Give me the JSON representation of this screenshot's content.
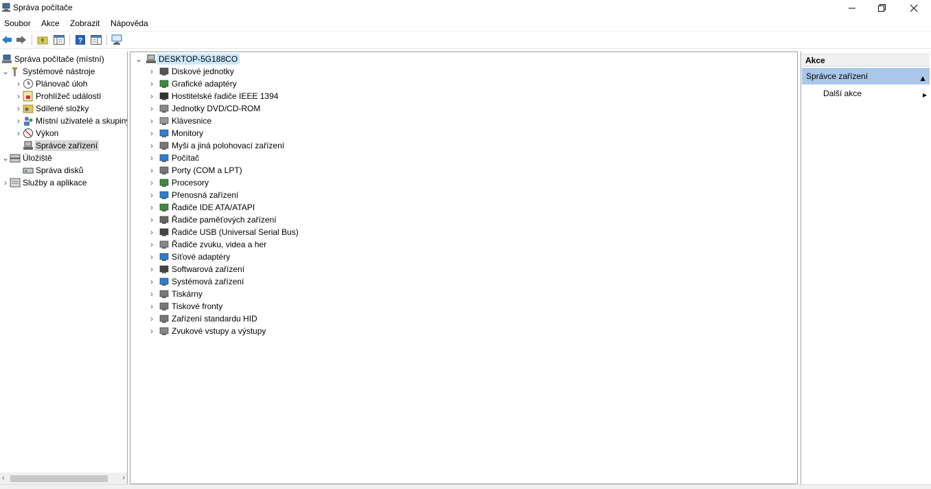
{
  "window": {
    "title": "Správa počítače"
  },
  "menu": {
    "file": "Soubor",
    "action": "Akce",
    "view": "Zobrazit",
    "help": "Nápověda"
  },
  "left_tree": {
    "root": "Správa počítače (místní)",
    "system_tools": "Systémové nástroje",
    "task_scheduler": "Plánovač úloh",
    "event_viewer": "Prohlížeč událostí",
    "shared_folders": "Sdílené složky",
    "local_users": "Místní uživatelé a skupiny",
    "performance": "Výkon",
    "device_manager": "Správce zařízení",
    "storage": "Úložiště",
    "disk_management": "Správa disků",
    "services": "Služby a aplikace"
  },
  "device_tree": {
    "computer": "DESKTOP-5G188CO",
    "categories": [
      {
        "label": "Diskové jednotky",
        "icon": "disk-drive-icon"
      },
      {
        "label": "Grafické adaptéry",
        "icon": "display-adapter-icon"
      },
      {
        "label": "Hostitelské řadiče IEEE 1394",
        "icon": "ieee1394-icon"
      },
      {
        "label": "Jednotky DVD/CD-ROM",
        "icon": "dvd-drive-icon"
      },
      {
        "label": "Klávesnice",
        "icon": "keyboard-icon"
      },
      {
        "label": "Monitory",
        "icon": "monitor-icon"
      },
      {
        "label": "Myši a jiná polohovací zařízení",
        "icon": "mouse-icon"
      },
      {
        "label": "Počítač",
        "icon": "computer-icon"
      },
      {
        "label": "Porty (COM a LPT)",
        "icon": "port-icon"
      },
      {
        "label": "Procesory",
        "icon": "processor-icon"
      },
      {
        "label": "Přenosná zařízení",
        "icon": "portable-device-icon"
      },
      {
        "label": "Řadiče IDE ATA/ATAPI",
        "icon": "ide-controller-icon"
      },
      {
        "label": "Řadiče paměťových zařízení",
        "icon": "storage-controller-icon"
      },
      {
        "label": "Řadiče USB (Universal Serial Bus)",
        "icon": "usb-icon"
      },
      {
        "label": "Řadiče zvuku, videa a her",
        "icon": "sound-icon"
      },
      {
        "label": "Síťové adaptéry",
        "icon": "network-adapter-icon"
      },
      {
        "label": "Softwarová zařízení",
        "icon": "software-device-icon"
      },
      {
        "label": "Systémová zařízení",
        "icon": "system-device-icon"
      },
      {
        "label": "Tiskárny",
        "icon": "printer-icon"
      },
      {
        "label": "Tiskové fronty",
        "icon": "print-queue-icon"
      },
      {
        "label": "Zařízení standardu HID",
        "icon": "hid-icon"
      },
      {
        "label": "Zvukové vstupy a výstupy",
        "icon": "audio-io-icon"
      }
    ]
  },
  "actions": {
    "header": "Akce",
    "selected": "Správce zařízení",
    "more": "Další akce"
  },
  "colors": {
    "selection_blue": "#cce8ff",
    "action_selected": "#a9c7e8",
    "tree_selected": "#d9d9d9"
  }
}
